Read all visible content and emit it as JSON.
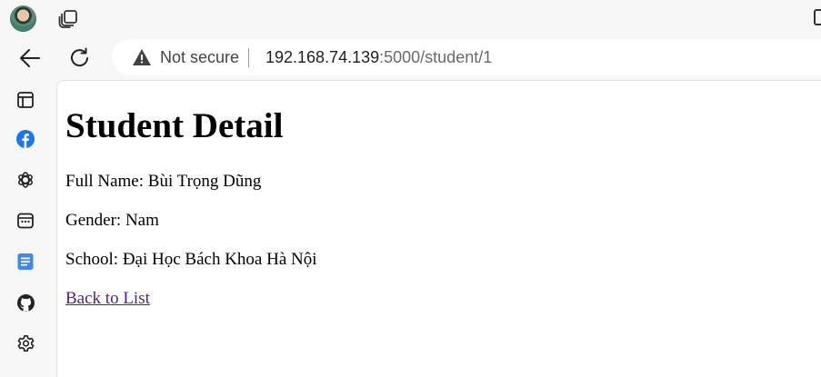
{
  "browser": {
    "address_bar": {
      "security_label": "Not secure",
      "url_host": "192.168.74.139",
      "url_rest": ":5000/student/1"
    },
    "icons": {
      "profile": "avatar",
      "tabs": "tab-actions-icon",
      "window": "window-icon",
      "back": "back-arrow-icon",
      "reload": "reload-icon",
      "security": "warning-triangle-icon"
    },
    "sidebar": [
      {
        "name": "collections-icon",
        "color": "#222222"
      },
      {
        "name": "facebook-icon",
        "color": "#1877f2"
      },
      {
        "name": "chatgpt-icon",
        "color": "#222222"
      },
      {
        "name": "calendar-app-icon",
        "color": "#222222"
      },
      {
        "name": "docs-icon",
        "color": "#4285f4"
      },
      {
        "name": "github-icon",
        "color": "#222222"
      },
      {
        "name": "settings-gear-icon",
        "color": "#222222"
      }
    ]
  },
  "page": {
    "title": "Student Detail",
    "full_name_label": "Full Name:",
    "full_name": "Bùi Trọng Dũng",
    "gender_label": "Gender:",
    "gender": "Nam",
    "school_label": "School:",
    "school": "Đại Học Bách Khoa Hà Nội",
    "back_link": "Back to List"
  },
  "colors": {
    "link_visited": "#551a8b",
    "chrome_background": "#f7f7f7",
    "page_background": "#ffffff"
  }
}
